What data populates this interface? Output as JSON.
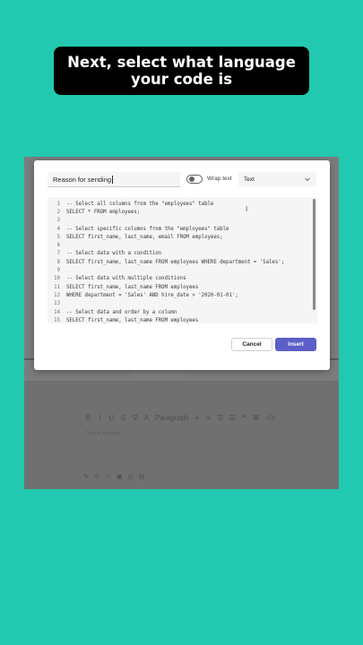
{
  "caption": "Next, select what language your code is",
  "dialog": {
    "title_value": "Reason for sending",
    "wrap_label": "Wrap text",
    "language_value": "Text",
    "cancel_label": "Cancel",
    "insert_label": "Insert",
    "code_lines": [
      {
        "n": "1",
        "t": "-- Select all columns from the \"employees\" table"
      },
      {
        "n": "2",
        "t": "SELECT * FROM employees;"
      },
      {
        "n": "3",
        "t": ""
      },
      {
        "n": "4",
        "t": "-- Select specific columns from the \"employees\" table"
      },
      {
        "n": "5",
        "t": "SELECT first_name, last_name, email FROM employees;"
      },
      {
        "n": "6",
        "t": ""
      },
      {
        "n": "7",
        "t": "-- Select data with a condition"
      },
      {
        "n": "8",
        "t": "SELECT first_name, last_name FROM employees WHERE department = 'Sales';"
      },
      {
        "n": "9",
        "t": ""
      },
      {
        "n": "10",
        "t": "-- Select data with multiple conditions"
      },
      {
        "n": "11",
        "t": "SELECT first_name, last_name FROM employees"
      },
      {
        "n": "12",
        "t": "WHERE department = 'Sales' AND hire_date > '2020-01-01';"
      },
      {
        "n": "13",
        "t": ""
      },
      {
        "n": "14",
        "t": "-- Select data and order by a column"
      },
      {
        "n": "15",
        "t": "SELECT first_name, last_name FROM employees"
      }
    ]
  },
  "background": {
    "toolbar_items": [
      "B",
      "I",
      "U",
      "S",
      "∇",
      "A",
      "Paragraph",
      "≡",
      "≡",
      "☰",
      "☰",
      "❝",
      "⌘",
      "</>"
    ],
    "message_placeholder": "Type a message",
    "bottom_icons": [
      "✎",
      "⊙",
      "☺",
      "▣",
      "◎",
      "▤"
    ]
  }
}
